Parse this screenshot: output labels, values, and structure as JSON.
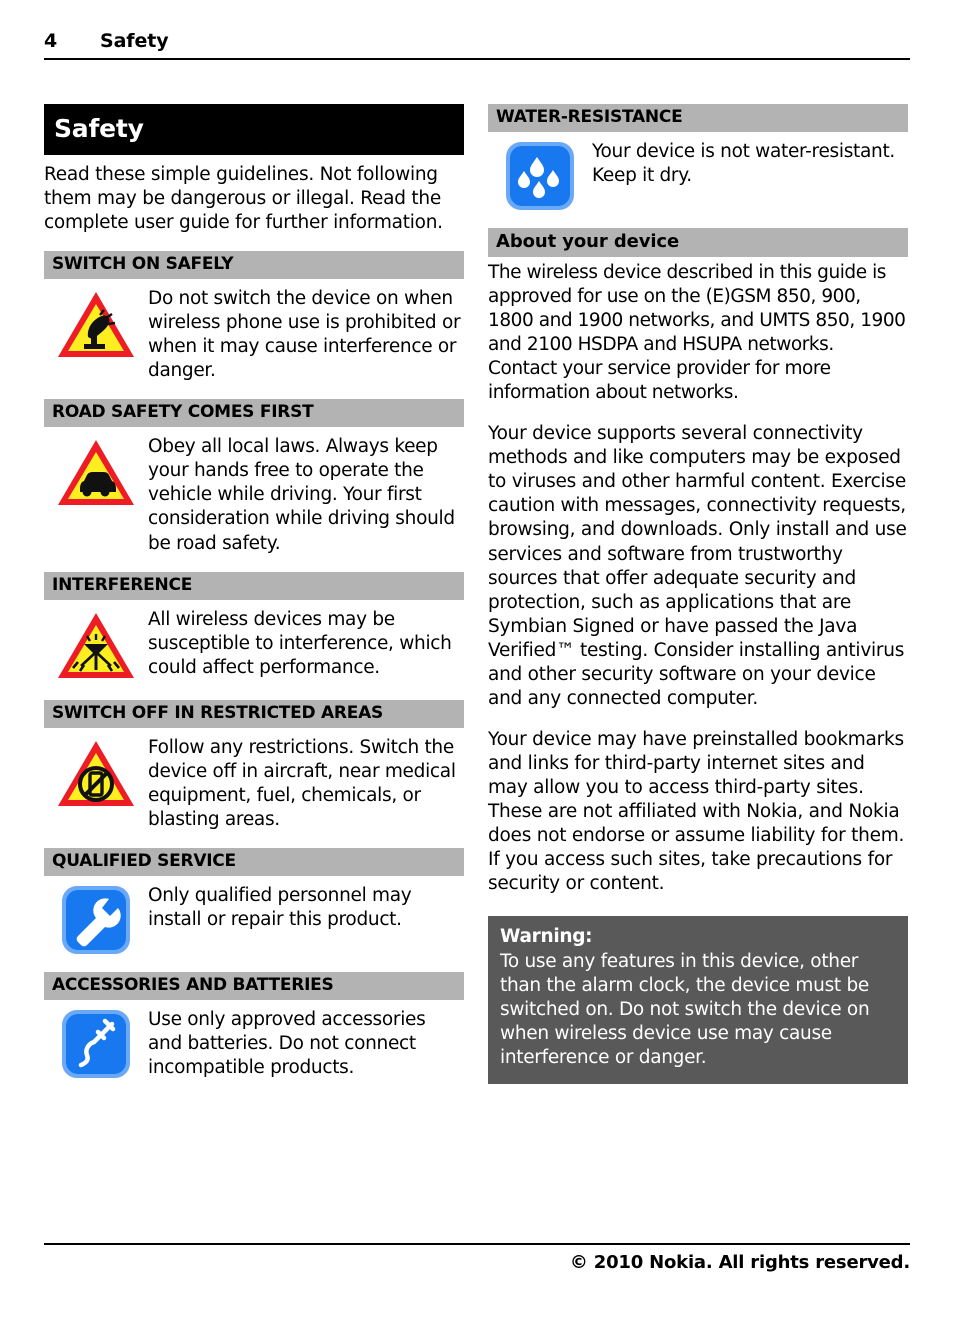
{
  "running_head": {
    "page_number": "4",
    "chapter": "Safety"
  },
  "chapter_title": "Safety",
  "intro": "Read these simple guidelines. Not following them may be dangerous or illegal. Read the complete user guide for further information.",
  "left_column": {
    "sections": [
      {
        "heading": "SWITCH ON SAFELY",
        "icon": "warning-triangle-hand-phone-icon",
        "text": "Do not switch the device on when wireless phone use is prohibited or when it may cause interference or danger."
      },
      {
        "heading": "ROAD SAFETY COMES FIRST",
        "icon": "warning-triangle-car-icon",
        "text": "Obey all local laws. Always keep your hands free to operate the vehicle while driving. Your first consideration while driving should be road safety."
      },
      {
        "heading": "INTERFERENCE",
        "icon": "warning-triangle-interference-icon",
        "text": "All wireless devices may be susceptible to interference, which could affect performance."
      },
      {
        "heading": "SWITCH OFF IN RESTRICTED AREAS",
        "icon": "warning-triangle-no-phone-icon",
        "text": "Follow any restrictions. Switch the device off in aircraft, near medical equipment, fuel, chemicals, or blasting areas."
      },
      {
        "heading": "QUALIFIED SERVICE",
        "icon": "blue-wrench-icon",
        "text": "Only qualified personnel may install or repair this product."
      },
      {
        "heading": "ACCESSORIES AND BATTERIES",
        "icon": "blue-connector-icon",
        "text": "Use only approved accessories and batteries. Do not connect incompatible products."
      }
    ]
  },
  "right_column": {
    "water_section": {
      "heading": "WATER-RESISTANCE",
      "icon": "blue-water-drops-icon",
      "text": "Your device is not water-resistant. Keep it dry."
    },
    "about_heading": "About your device",
    "about_paragraphs": [
      "The wireless device described in this guide is approved for use on the (E)GSM 850, 900, 1800 and 1900 networks, and UMTS 850, 1900 and 2100 HSDPA and HSUPA networks. Contact your service provider for more information about networks.",
      "Your device supports several connectivity methods and like computers may be exposed to viruses and other harmful content. Exercise caution with messages, connectivity requests, browsing, and downloads. Only install and use services and software from trustworthy sources that offer adequate security and protection, such as applications that are Symbian Signed or have passed the Java Verified™ testing. Consider installing antivirus and other security software on your device and any connected computer.",
      "Your device may have preinstalled bookmarks and links for third-party internet sites and may allow you to access third-party sites. These are not affiliated with Nokia, and Nokia does not endorse or assume liability for them. If you access such sites, take precautions for security or content."
    ],
    "warning": {
      "label": "Warning:",
      "text": "To use any features in this device, other than the alarm clock, the device must be switched on. Do not switch the device on when wireless device use may cause interference or danger."
    }
  },
  "footer": "© 2010 Nokia. All rights reserved.",
  "colors": {
    "title_bar_bg": "#000000",
    "section_bar_bg": "#b3b3b3",
    "warning_box_bg": "#595959",
    "icon_blue": "#1878f0",
    "icon_blue_glow": "#6aa9f7",
    "triangle_yellow": "#fcee21",
    "triangle_red": "#ee1c25"
  }
}
